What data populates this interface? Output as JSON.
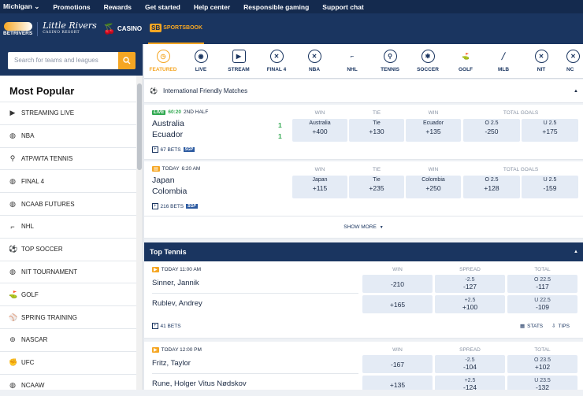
{
  "topnav": {
    "state": "Michigan",
    "items": [
      "Promotions",
      "Rewards",
      "Get started",
      "Help center",
      "Responsible gaming",
      "Support chat"
    ]
  },
  "brands": {
    "betrivers": "BETRIVERS",
    "little_rivers": "Little Rivers",
    "little_rivers_sub": "CASINO RESORT",
    "casino": "CASINO",
    "sportsbook_badge": "SB",
    "sportsbook": "SPORTSBOOK"
  },
  "search": {
    "placeholder": "Search for teams and leagues"
  },
  "sidebar": {
    "title": "Most Popular",
    "items": [
      {
        "label": "STREAMING LIVE",
        "icon": "play-icon"
      },
      {
        "label": "NBA",
        "icon": "basketball-icon"
      },
      {
        "label": "ATP/WTA TENNIS",
        "icon": "tennis-icon"
      },
      {
        "label": "FINAL 4",
        "icon": "basketball-icon"
      },
      {
        "label": "NCAAB FUTURES",
        "icon": "basketball-icon"
      },
      {
        "label": "NHL",
        "icon": "hockey-icon"
      },
      {
        "label": "TOP SOCCER",
        "icon": "soccer-icon"
      },
      {
        "label": "NIT TOURNAMENT",
        "icon": "basketball-icon"
      },
      {
        "label": "GOLF",
        "icon": "golf-icon"
      },
      {
        "label": "SPRING TRAINING",
        "icon": "baseball-icon"
      },
      {
        "label": "NASCAR",
        "icon": "racing-icon"
      },
      {
        "label": "UFC",
        "icon": "ufc-icon"
      },
      {
        "label": "NCAAW",
        "icon": "basketball-icon"
      }
    ]
  },
  "sports_tabs": [
    {
      "label": "FEATURED",
      "icon": "clock-icon",
      "active": true
    },
    {
      "label": "LIVE",
      "icon": "live-icon"
    },
    {
      "label": "STREAM",
      "icon": "stream-icon"
    },
    {
      "label": "FINAL 4",
      "icon": "basketball-icon"
    },
    {
      "label": "NBA",
      "icon": "basketball-icon"
    },
    {
      "label": "NHL",
      "icon": "hockey-icon"
    },
    {
      "label": "TENNIS",
      "icon": "tennis-icon"
    },
    {
      "label": "SOCCER",
      "icon": "soccer-icon"
    },
    {
      "label": "GOLF",
      "icon": "golf-icon"
    },
    {
      "label": "MLB",
      "icon": "baseball-icon"
    },
    {
      "label": "NIT",
      "icon": "basketball-icon"
    },
    {
      "label": "NC",
      "icon": "basketball-icon"
    }
  ],
  "soccer_section": {
    "title": "International Friendly Matches",
    "columns": [
      "WIN",
      "TIE",
      "WIN",
      "TOTAL GOALS"
    ],
    "events": [
      {
        "badge": "LIVE",
        "time": "60:20",
        "period": "2ND HALF",
        "home": "Australia",
        "away": "Ecuador",
        "home_score": "1",
        "away_score": "1",
        "bets": "67 BETS",
        "sgp": "SGP",
        "odds": [
          {
            "label": "Australia",
            "value": "+400"
          },
          {
            "label": "Tie",
            "value": "+130"
          },
          {
            "label": "Ecuador",
            "value": "+135"
          },
          {
            "label": "O 2.5",
            "value": "-250"
          },
          {
            "label": "U 2.5",
            "value": "+175"
          }
        ]
      },
      {
        "badge": "TODAY",
        "time": "6:20 AM",
        "home": "Japan",
        "away": "Colombia",
        "bets": "216 BETS",
        "sgp": "SGP",
        "odds": [
          {
            "label": "Japan",
            "value": "+115"
          },
          {
            "label": "Tie",
            "value": "+235"
          },
          {
            "label": "Colombia",
            "value": "+250"
          },
          {
            "label": "O 2.5",
            "value": "+128"
          },
          {
            "label": "U 2.5",
            "value": "-159"
          }
        ]
      }
    ],
    "show_more": "SHOW MORE"
  },
  "tennis_section": {
    "title": "Top Tennis",
    "columns": [
      "WIN",
      "SPREAD",
      "TOTAL"
    ],
    "events": [
      {
        "time": "TODAY 11:00 AM",
        "p1": "Sinner, Jannik",
        "p2": "Rublev, Andrey",
        "p1_win": "-210",
        "p1_spread_lbl": "-2.5",
        "p1_spread": "-127",
        "p1_total_lbl": "O 22.5",
        "p1_total": "-117",
        "p2_win": "+165",
        "p2_spread_lbl": "+2.5",
        "p2_spread": "+100",
        "p2_total_lbl": "U 22.5",
        "p2_total": "-109",
        "bets": "41 BETS",
        "stats": "STATS",
        "tips": "TIPS"
      },
      {
        "time": "TODAY 12:00 PM",
        "p1": "Fritz, Taylor",
        "p2": "Rune, Holger Vitus Nødskov",
        "p1_win": "-167",
        "p1_spread_lbl": "-2.5",
        "p1_spread": "-104",
        "p1_total_lbl": "O 23.5",
        "p1_total": "+102",
        "p2_win": "+135",
        "p2_spread_lbl": "+2.5",
        "p2_spread": "-124",
        "p2_total_lbl": "U 23.5",
        "p2_total": "-132"
      }
    ]
  },
  "colors": {
    "navy": "#1a3560",
    "accent": "#f5a623",
    "live_green": "#2fa84f",
    "odds_bg": "#e4ebf5"
  }
}
